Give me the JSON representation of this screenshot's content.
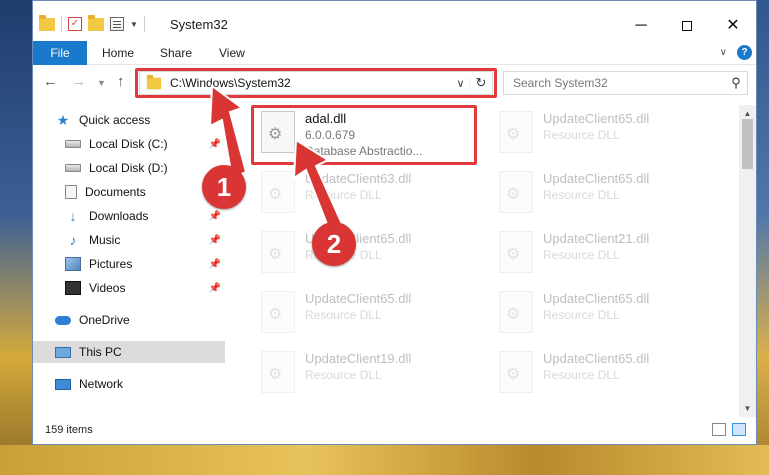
{
  "window": {
    "title": "System32"
  },
  "ribbon": {
    "tabs": [
      "File",
      "Home",
      "Share",
      "View"
    ],
    "help": "?"
  },
  "address": {
    "path": "C:\\Windows\\System32",
    "search_placeholder": "Search System32"
  },
  "nav_pane": {
    "items": [
      {
        "label": "Quick access",
        "icon": "star-icon",
        "pinned": false
      },
      {
        "label": "Local Disk (C:)",
        "icon": "drive-icon",
        "pinned": true
      },
      {
        "label": "Local Disk (D:)",
        "icon": "drive-icon",
        "pinned": false
      },
      {
        "label": "Documents",
        "icon": "documents-icon",
        "pinned": false
      },
      {
        "label": "Downloads",
        "icon": "download-icon",
        "pinned": true
      },
      {
        "label": "Music",
        "icon": "music-icon",
        "pinned": true
      },
      {
        "label": "Pictures",
        "icon": "pictures-icon",
        "pinned": true
      },
      {
        "label": "Videos",
        "icon": "videos-icon",
        "pinned": true
      },
      {
        "label": "OneDrive",
        "icon": "cloud-icon",
        "pinned": false
      },
      {
        "label": "This PC",
        "icon": "pc-icon",
        "pinned": false,
        "selected": true
      },
      {
        "label": "Network",
        "icon": "network-icon",
        "pinned": false
      }
    ]
  },
  "files": {
    "primary": {
      "name": "adal.dll",
      "version": "6.0.0.679",
      "description": "Database Abstractio..."
    },
    "faded": [
      {
        "name": "UpdateClient65.dll",
        "type": "Resource DLL"
      },
      {
        "name": "UpdateClient63.dll",
        "type": "Resource DLL"
      },
      {
        "name": "UpdateClient65.dll",
        "type": "Resource DLL"
      },
      {
        "name": "UpdateClient65.dll",
        "type": "Resource DLL"
      },
      {
        "name": "UpdateClient21.dll",
        "type": "Resource DLL"
      },
      {
        "name": "UpdateClient65.dll",
        "type": "Resource DLL"
      },
      {
        "name": "UpdateClient65.dll",
        "type": "Resource DLL"
      },
      {
        "name": "UpdateClient19.dll",
        "type": "Resource DLL"
      },
      {
        "name": "UpdateClient65.dll",
        "type": "Resource DLL"
      }
    ]
  },
  "status": {
    "count": "159 items"
  },
  "annotations": {
    "step1": "1",
    "step2": "2",
    "color": "#d93535"
  }
}
